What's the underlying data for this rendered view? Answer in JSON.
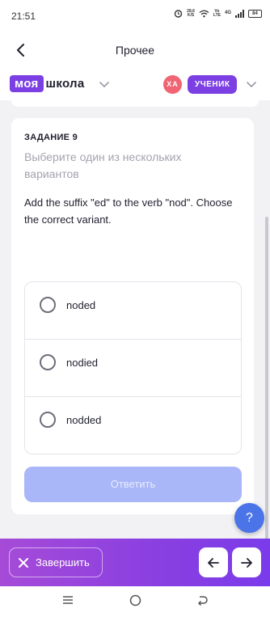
{
  "status_bar": {
    "time": "21:51",
    "net_speed_value": "28,6",
    "net_speed_unit": "K/S",
    "network_type_top": "Vo",
    "network_type_bottom": "LTE",
    "signal_label": "4G",
    "battery": "84"
  },
  "nav": {
    "title": "Прочее"
  },
  "brand": {
    "logo_part1": "моя",
    "logo_part2": "школа",
    "avatar_initials": "ХА",
    "role": "УЧЕНИК"
  },
  "task": {
    "label": "ЗАДАНИЕ 9",
    "hint": "Выберите один из нескольких вариантов",
    "question": "Add the suffix \"ed\" to the verb \"nod\". Choose the correct variant.",
    "options": [
      {
        "text": "noded"
      },
      {
        "text": "nodied"
      },
      {
        "text": "nodded"
      }
    ],
    "submit_label": "Ответить"
  },
  "help": {
    "label": "?"
  },
  "bottom": {
    "finish_label": "Завершить"
  },
  "colors": {
    "brand_purple": "#7b3fe4",
    "avatar_red": "#f06473",
    "submit_disabled": "#a9b6f7",
    "help_blue": "#4a74e8"
  }
}
